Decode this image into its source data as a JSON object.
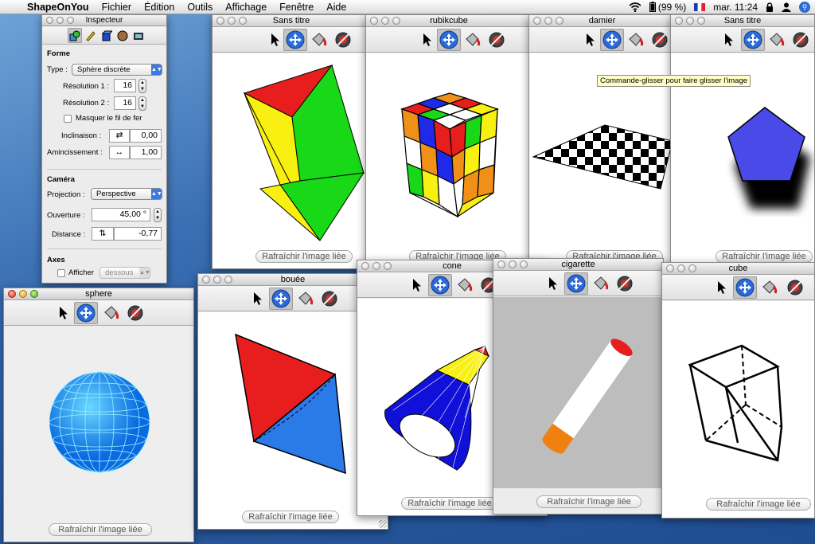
{
  "menubar": {
    "app": "ShapeOnYou",
    "items": [
      "Fichier",
      "Édition",
      "Outils",
      "Affichage",
      "Fenêtre",
      "Aide"
    ],
    "battery": "(99 %)",
    "clock": "mar. 11:24",
    "icons": [
      "apple-icon",
      "wifi-icon",
      "battery-icon",
      "flag-icon",
      "lock-icon",
      "user-icon",
      "spotlight-icon"
    ]
  },
  "tool_icons": [
    "arrow-pointer-icon",
    "move-cross-icon",
    "paint-bucket-icon",
    "color-wheel-icon"
  ],
  "refresh_label": "Rafraîchir l'image liée",
  "tooltip": "Commande-glisser pour faire glisser l'image",
  "inspector": {
    "title": "Inspecteur",
    "tab_icons": [
      "shape-tab-icon",
      "pencil-tab-icon",
      "cube-tab-icon",
      "texture-tab-icon",
      "film-tab-icon"
    ],
    "forme": {
      "heading": "Forme",
      "type_label": "Type :",
      "type_value": "Sphère discrète",
      "res1_label": "Résolution 1 :",
      "res1_value": "16",
      "res2_label": "Résolution 2 :",
      "res2_value": "16",
      "wire_label": "Masquer le fil de fer",
      "tilt_label": "Inclinaison :",
      "tilt_value": "0,00",
      "thin_label": "Amincissement :",
      "thin_value": "1,00"
    },
    "camera": {
      "heading": "Caméra",
      "proj_label": "Projection :",
      "proj_value": "Perspective",
      "open_label": "Ouverture :",
      "open_value": "45,00 °",
      "dist_label": "Distance :",
      "dist_value": "-0,77"
    },
    "axes": {
      "heading": "Axes",
      "show_label": "Afficher",
      "pos_value": "dessous"
    }
  },
  "windows": {
    "sans_titre_1": {
      "title": "Sans titre"
    },
    "rubikcube": {
      "title": "rubikcube"
    },
    "damier": {
      "title": "damier"
    },
    "sans_titre_2": {
      "title": "Sans titre"
    },
    "sphere": {
      "title": "sphere"
    },
    "bouee": {
      "title": "bouée"
    },
    "cone": {
      "title": "cone"
    },
    "cigarette": {
      "title": "cigarette"
    },
    "cube": {
      "title": "cube"
    }
  },
  "colors": {
    "selected_tool": "#c4c4c4",
    "tooltip_bg": "#ffffc6",
    "desktop": "#2a5aa0"
  }
}
